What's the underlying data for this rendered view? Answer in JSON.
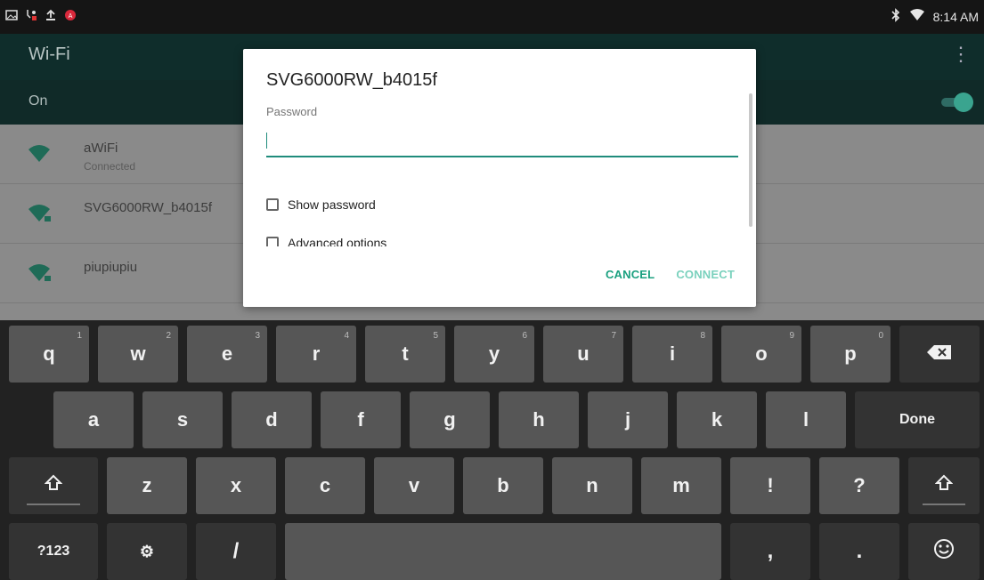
{
  "status_bar": {
    "time": "8:14 AM",
    "left_icons": [
      "gallery-icon",
      "usb-icon",
      "upload-icon",
      "adobe-icon"
    ],
    "right_icons": [
      "bluetooth-icon",
      "wifi-signal-icon"
    ]
  },
  "header": {
    "title": "Wi-Fi",
    "overflow_icon": "overflow-menu-icon"
  },
  "wifi_toggle": {
    "label": "On",
    "state": "on"
  },
  "networks": [
    {
      "name": "aWiFi",
      "status": "Connected"
    },
    {
      "name": "SVG6000RW_b4015f",
      "status": ""
    },
    {
      "name": "piupiupiu",
      "status": ""
    }
  ],
  "dialog": {
    "title": "SVG6000RW_b4015f",
    "password_label": "Password",
    "password_value": "",
    "show_password_label": "Show password",
    "advanced_label": "Advanced options",
    "cancel_label": "CANCEL",
    "connect_label": "CONNECT"
  },
  "keyboard": {
    "row1": [
      {
        "label": "q",
        "sup": "1"
      },
      {
        "label": "w",
        "sup": "2"
      },
      {
        "label": "e",
        "sup": "3"
      },
      {
        "label": "r",
        "sup": "4"
      },
      {
        "label": "t",
        "sup": "5"
      },
      {
        "label": "y",
        "sup": "6"
      },
      {
        "label": "u",
        "sup": "7"
      },
      {
        "label": "i",
        "sup": "8"
      },
      {
        "label": "o",
        "sup": "9"
      },
      {
        "label": "p",
        "sup": "0"
      }
    ],
    "backspace_icon": "backspace-icon",
    "row2": [
      "a",
      "s",
      "d",
      "f",
      "g",
      "h",
      "j",
      "k",
      "l"
    ],
    "done_label": "Done",
    "row3": [
      "z",
      "x",
      "c",
      "v",
      "b",
      "n",
      "m",
      "!",
      "?"
    ],
    "shift_icon": "shift-icon",
    "bottom": {
      "symbols_label": "?123",
      "settings_icon": "keyboard-settings-icon",
      "slash": "/",
      "comma": ",",
      "period": ".",
      "emoji_icon": "emoji-icon"
    }
  },
  "colors": {
    "accent": "#1aa07f",
    "statusbar": "#151515",
    "actionbar": "#0f2d2b",
    "keyboard_bg": "#222222"
  }
}
